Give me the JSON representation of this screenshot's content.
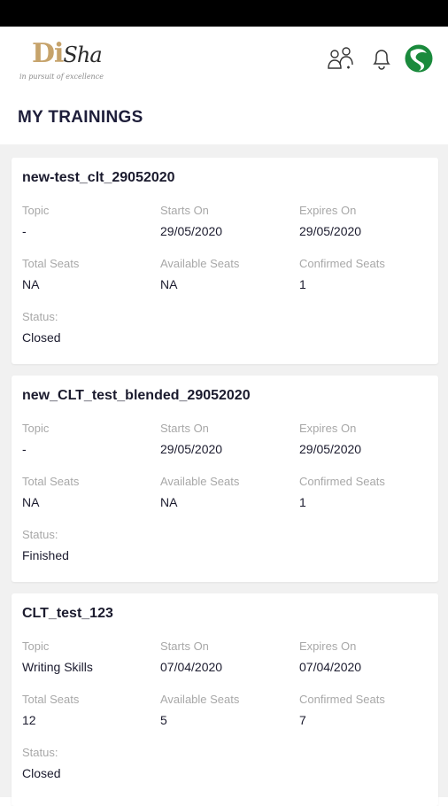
{
  "app": {
    "logo_text": "DiSha",
    "logo_tagline": "in pursuit of excellence"
  },
  "header": {
    "icons": [
      "people-icon",
      "bell-icon",
      "avatar-icon"
    ],
    "accent_color": "#1a8a3c"
  },
  "page": {
    "title": "MY TRAININGS"
  },
  "labels": {
    "topic": "Topic",
    "starts_on": "Starts On",
    "expires_on": "Expires On",
    "total_seats": "Total Seats",
    "available_seats": "Available Seats",
    "confirmed_seats": "Confirmed Seats",
    "status": "Status:"
  },
  "trainings": [
    {
      "name": "new-test_clt_29052020",
      "topic": "-",
      "starts_on": "29/05/2020",
      "expires_on": "29/05/2020",
      "total_seats": "NA",
      "available_seats": "NA",
      "confirmed_seats": "1",
      "status": "Closed"
    },
    {
      "name": "new_CLT_test_blended_29052020",
      "topic": "-",
      "starts_on": "29/05/2020",
      "expires_on": "29/05/2020",
      "total_seats": "NA",
      "available_seats": "NA",
      "confirmed_seats": "1",
      "status": "Finished"
    },
    {
      "name": "CLT_test_123",
      "topic": "Writing Skills",
      "starts_on": "07/04/2020",
      "expires_on": "07/04/2020",
      "total_seats": "12",
      "available_seats": "5",
      "confirmed_seats": "7",
      "status": "Closed"
    }
  ]
}
